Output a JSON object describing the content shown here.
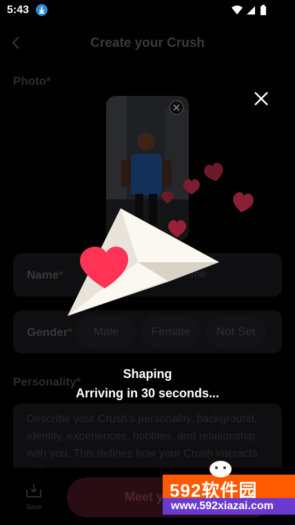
{
  "status": {
    "time": "5:43"
  },
  "header": {
    "title": "Create your Crush"
  },
  "photo": {
    "label": "Photo",
    "required": "*"
  },
  "name": {
    "label": "Name",
    "required": "*",
    "placeholder": "me"
  },
  "gender": {
    "label": "Gender",
    "required": "*",
    "options": [
      "Male",
      "Female",
      "Not Set"
    ]
  },
  "personality": {
    "label": "Personality",
    "required": "*",
    "placeholder": "Describe your Crush's personality, background, identity, experiences, hobbies, and relationship with you. This defines how your Crush interacts with you."
  },
  "bottom": {
    "save_label": "Save",
    "meet_label": "Meet y"
  },
  "loading": {
    "title": "Shaping",
    "subtitle": "Arriving in 30 seconds..."
  },
  "watermark": {
    "brand": "592软件园",
    "url": "www.592xiazai.com"
  },
  "colors": {
    "heart": "#ff3355",
    "heart_dim": "#6b1a2a",
    "accent": "#2a0c15"
  }
}
